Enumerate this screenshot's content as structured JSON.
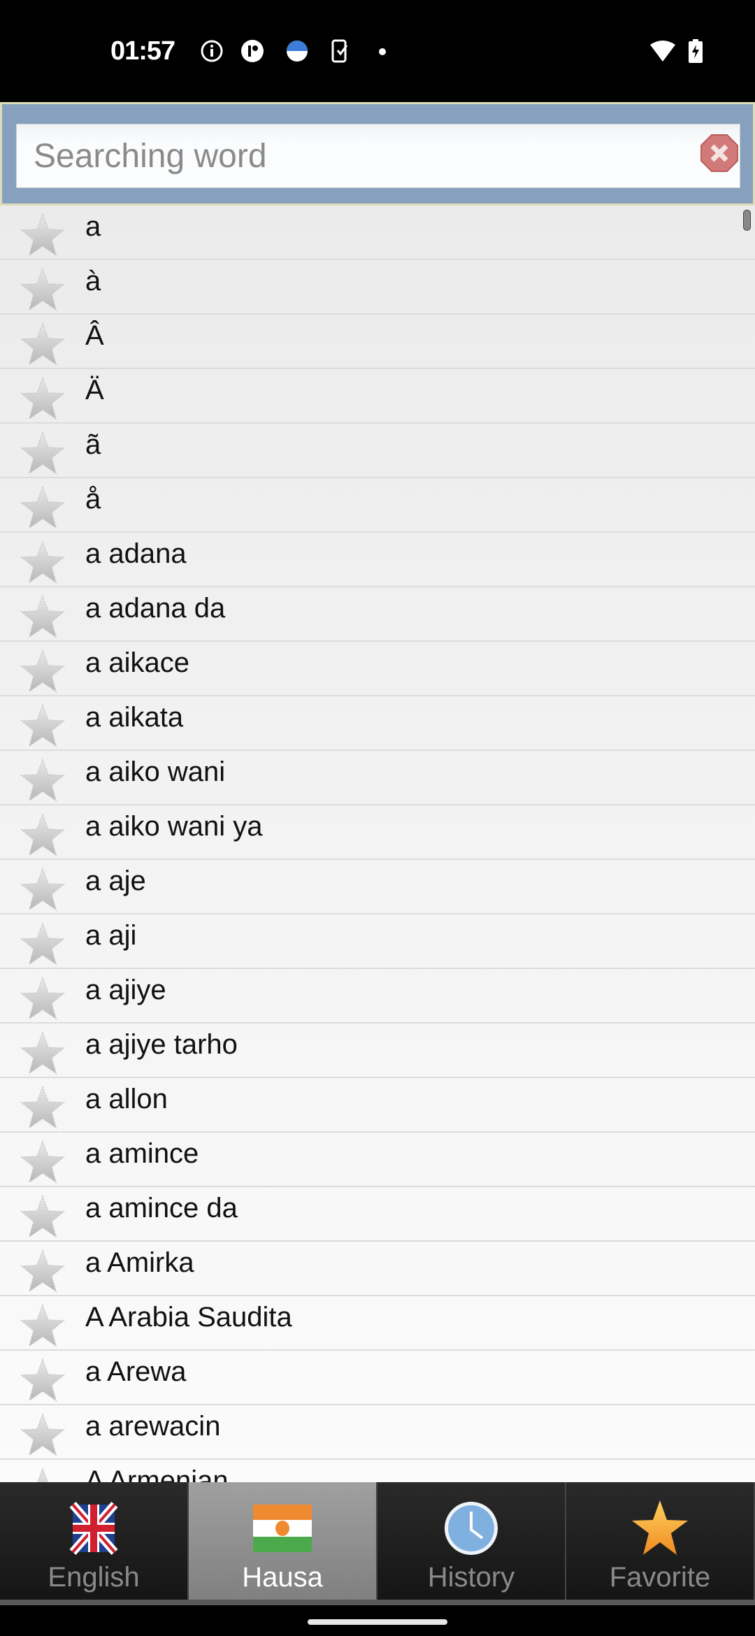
{
  "status_bar": {
    "time": "01:57",
    "icons": [
      "info-icon",
      "p-app-icon",
      "test-calendar-icon",
      "phone-check-icon",
      "dot-icon",
      "wifi-icon",
      "battery-charging-icon"
    ]
  },
  "search": {
    "placeholder": "Searching word",
    "value": "",
    "clear_icon": "clear-stop-icon"
  },
  "words": [
    "a",
    "à",
    "Â",
    "Ä",
    "ã",
    "å",
    "a adana",
    "a adana da",
    "a aikace",
    "a aikata",
    "a aiko wani",
    "a aiko wani ya",
    "a aje",
    "a aji",
    "a ajiye",
    "a ajiye tarho",
    "a allon",
    "a amince",
    "a amince da",
    "a Amirka",
    "A Arabia Saudita",
    "a Arewa",
    "a arewacin",
    "A Armenian"
  ],
  "nav": {
    "tabs": [
      {
        "label": "English",
        "icon": "uk-flag-icon",
        "active": false
      },
      {
        "label": "Hausa",
        "icon": "niger-flag-icon",
        "active": true
      },
      {
        "label": "History",
        "icon": "clock-icon",
        "active": false
      },
      {
        "label": "Favorite",
        "icon": "star-icon",
        "active": false
      }
    ]
  },
  "colors": {
    "search_band": "#87a0bd",
    "active_tab": "#909090",
    "favorite_star": "#f5a623"
  }
}
